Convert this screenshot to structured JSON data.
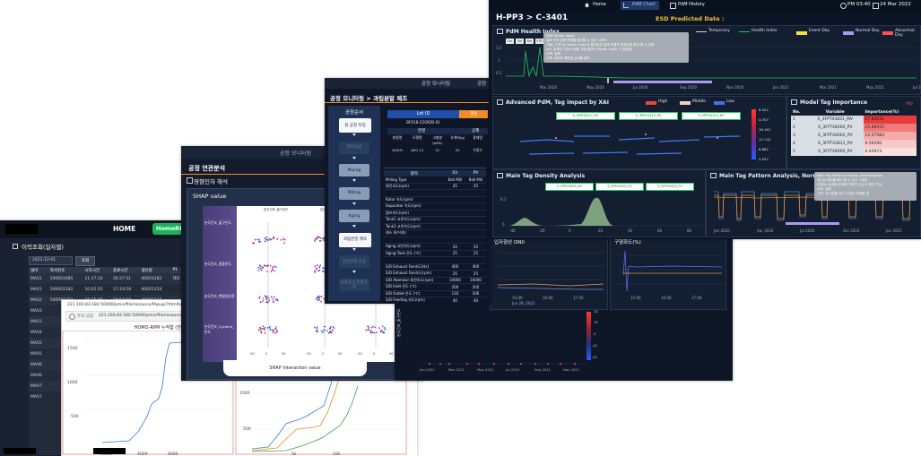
{
  "w1": {
    "header": {
      "home": "HOME",
      "brand": "HomoRPM"
    },
    "section_title": "이력조회(일자별)",
    "filter": {
      "date": "2021-12-01",
      "btn": "조회"
    },
    "table": {
      "headers": [
        "설비",
        "작사번호",
        "시작시간",
        "종료시간",
        "생산량",
        "P1",
        "P2"
      ],
      "rows": [
        [
          "MA01",
          "500001985",
          "11:17:14",
          "20:27:51",
          "40001282",
          "제조 공정",
          "CT"
        ],
        [
          "MA01",
          "500002182",
          "10:02:52",
          "17:19:18",
          "40001254",
          "",
          ""
        ],
        [
          "MA02",
          "500001152",
          "16:36:35",
          "20:54:58",
          "40001218",
          "",
          ""
        ],
        [
          "MA03",
          "",
          "",
          "",
          "",
          "",
          ""
        ],
        [
          "MA03",
          "",
          "",
          "",
          "",
          "",
          ""
        ],
        [
          "MA04",
          "",
          "",
          "",
          "",
          "",
          ""
        ],
        [
          "MA05",
          "",
          "",
          "",
          "",
          "",
          ""
        ],
        [
          "MA05",
          "",
          "",
          "",
          "",
          "",
          ""
        ],
        [
          "MA06",
          "",
          "",
          "",
          "",
          "",
          ""
        ],
        [
          "MA06",
          "",
          "",
          "",
          "",
          "",
          ""
        ],
        [
          "MA07",
          "",
          "",
          "",
          "",
          "",
          ""
        ],
        [
          "MA07",
          "",
          "",
          "",
          "",
          "",
          ""
        ]
      ]
    },
    "popup": {
      "url_top": "221.160.83.182:50000/pmis/file/resource/Popup/?htmlfuag_code=MA",
      "url_label": "주의 요함",
      "url": "221.160.83.182:50000/pmis/file/resource/Popup/?htmlfu...",
      "chart_title": "HOMO-RPM 누적합 (전체)",
      "left_yticks": [
        "1500",
        "1000",
        "500"
      ],
      "left_xticks": [
        "2000",
        "4000",
        "6000"
      ],
      "right_yticks": [
        "1500",
        "1000",
        "500"
      ],
      "right_xticks": [
        "5k",
        "10k"
      ]
    }
  },
  "w2": {
    "top_title": "공정 모니터링",
    "title": "공정 연관분석",
    "subtitle": "영향인자 해석",
    "shap_label": "SHAP value",
    "features": [
      "분무건조_출구온도",
      "분무건조_열풍온도",
      "분무건조_헥질량유량",
      "분무건조_Cyclone_온도"
    ],
    "col_labels": [
      "분무건조_출구온도",
      "분무건조_열풍온도",
      "분무건조_헥"
    ],
    "xlabel": "SHAP interaction value",
    "xticks": [
      "-50",
      "0",
      "50"
    ]
  },
  "w3": {
    "top_title": "공정 모니터링",
    "top_title2": "공정",
    "title": "공정 모니터링 > 과립분말 제조",
    "seq_title": "공정순서",
    "steps": [
      "원 공정 투입",
      "원료공급",
      "Mixing",
      "Milling",
      "Aging",
      "과립분말 제조",
      "분말공정 운송",
      "공용공시 반출공정"
    ],
    "lot_label": "Lot ID",
    "lot_value": "BF018-22092B-01",
    "lot_right": "과립",
    "sub_headers": [
      "분말",
      "",
      "공제"
    ],
    "col_headers": [
      "분말명",
      "모델명",
      "고형분 (wt%)",
      "유개비(g)",
      "용제명"
    ],
    "col_values": [
      "AQ03I",
      "AEO-11",
      "21",
      "25",
      "수용수"
    ],
    "param_head": [
      "항목",
      "SV",
      "PV"
    ],
    "params": [
      [
        "Milling Type",
        "Ball Mill",
        "Ball Mill"
      ],
      [
        "회전속도(rpm)",
        "45",
        "45"
      ],
      [
        "",
        "",
        " "
      ],
      [
        "Rotor 속도(rpm)",
        "",
        ""
      ],
      [
        "Separator 속도(rpm)",
        "",
        ""
      ],
      [
        "펌프속도(rpm)",
        "",
        ""
      ],
      [
        "Tank1 교반속도(rpm)",
        "",
        ""
      ],
      [
        "Tank2 교반속도(rpm)",
        "",
        ""
      ],
      [
        "레스 회수(회)",
        "",
        ""
      ],
      [
        "",
        "",
        ""
      ],
      [
        "Aging 교반속도(rpm)",
        "20",
        "20"
      ],
      [
        "Aging Tank 온도 (℃)",
        "25",
        "25"
      ],
      [
        "",
        "",
        ""
      ],
      [
        "S/D Exhaust Fan속도(Hz)",
        "400",
        "400"
      ],
      [
        "S/D Exhaust Fan속도(rpm)",
        "25",
        "25"
      ],
      [
        "S/D Atomizer 회전속도(rpm)",
        "10000",
        "10000"
      ],
      [
        "S/D Inlet 온도 (℃)",
        "200",
        "200"
      ],
      [
        "S/D Outlet 온도 (℃)",
        "110",
        "106"
      ],
      [
        "S/D Feeding 속도(rpm)",
        "40",
        "40"
      ]
    ]
  },
  "w5": {
    "chart1_title": "입자형상 DN0",
    "chart2_title": "구형화도(%)",
    "date_label": "Jun 28, 2022",
    "time_ticks": [
      "15:00",
      "16:00",
      "17:00"
    ],
    "time_ticks2": [
      "15:00",
      "16:00",
      "17:00"
    ],
    "heat_ylabel": "분무건조_출구온도",
    "heat_xticks": [
      "Jan 2021",
      "Mar 2021",
      "May 2021",
      "Jul 2021",
      "Sep 2021",
      "Nov 2021"
    ],
    "heat_scale": [
      "20",
      "10",
      "0",
      "-10",
      "-20"
    ]
  },
  "w4": {
    "nav": {
      "home": "Home",
      "pdm_chart": "PdM Chart",
      "pdm_history": "PdM History",
      "time": "PM 03:40",
      "date": "24 Mar 2022"
    },
    "title": "H-PP3 > C-3401",
    "esd": "ESD Predicted Date :",
    "health": {
      "title": "PdM Health Index",
      "legend": [
        "Temporary",
        "Health Index",
        "Event Day",
        "Normal Day",
        "Abnormal Day"
      ],
      "zoom_btns": [
        "1m",
        "3m",
        "6m",
        "YTD",
        "1y",
        "All"
      ],
      "yticks": [
        "1.5",
        "1",
        "0.5"
      ],
      "xticks": [
        "Mar 2020",
        "May 2020",
        "Jul 2020",
        "Sep 2020",
        "Nov 2020",
        "Jan 2021",
        "Mar 2021",
        "May 2021",
        "Jul 2021",
        "Sep 2021",
        "Nov 2021",
        "Jan 2022"
      ],
      "tooltip": [
        "PdM Health Index",
        "설비 전체 상태 판매를 확인할 수 있는 그래프",
        "/계승: 기준 내 Health index의 월차일본 통해 모델의 적정성을 확인 할 수 있음",
        "/ex: 설계의 고장이 났을 시에 해당인 Health index 기 반영됨)",
        "/X축: 날짜",
        "/Y축: 데이터 예측값 상태을 출력"
      ]
    },
    "xai": {
      "title": "Advanced PdM, Tag impact by XAI",
      "legend": [
        "High",
        "Middle",
        "Low"
      ],
      "tags": [
        "X_SPPH4411_RV",
        "X_3PPH4410_RV",
        "X_SPPH4414_RV"
      ],
      "scale": [
        "8.522",
        "4.707",
        "16.161",
        "12.142",
        "8.882",
        "2.057"
      ]
    },
    "importance": {
      "title": "Model Tag Importance",
      "unit": "(%)",
      "headers": [
        "No.",
        "Variable",
        "Importance(%)"
      ],
      "rows": [
        [
          "1",
          "X_3FPT43831_MV",
          "27.84535"
        ],
        [
          "2",
          "X_3FFT44000_PV",
          "25.86925"
        ],
        [
          "3",
          "X_3FPT44002_PV",
          "15.57583"
        ],
        [
          "4",
          "X_3FPT43811_PV",
          "9.56200"
        ],
        [
          "5",
          "X_3FFT44000_PV",
          "6.02973"
        ]
      ]
    },
    "density": {
      "title": "Main Tag Density Analysis",
      "tags": [
        "X_3PPH3833_MV",
        "X_3PFH3031_PV",
        "X_2PPH3433_PV"
      ],
      "yticks": [
        "0.1",
        "0"
      ],
      "xticks": [
        "-40",
        "-20",
        "0",
        "20",
        "40",
        "60",
        "80"
      ]
    },
    "pattern": {
      "title": "Main Tag Pattern Analysis, Normalization",
      "tooltip": [
        "Main Tag Pattern Analysis, Normalization",
        "재그상 패턴을 확인 할 수 있는 그래프",
        "/비정상 상태일 때 패턴 변화가 있는지 확인 가능",
        "/X축: 날짜",
        "/Y축: 재그값을 0과 1사이로 조정한 값"
      ],
      "xticks": [
        "Jan 2020",
        "Apr 2020",
        "Jul 2020",
        "Oct 2020",
        "Jan 2021"
      ]
    }
  },
  "colors": {
    "accent_orange": "#f28c28",
    "green": "#19b35a",
    "blue": "#1f6fe0",
    "navy": "#0b1424",
    "health_green": "#22c55e",
    "event_yellow": "#f2e33a",
    "normal_purple": "#a89af0",
    "abnormal_red": "#ff5050"
  }
}
